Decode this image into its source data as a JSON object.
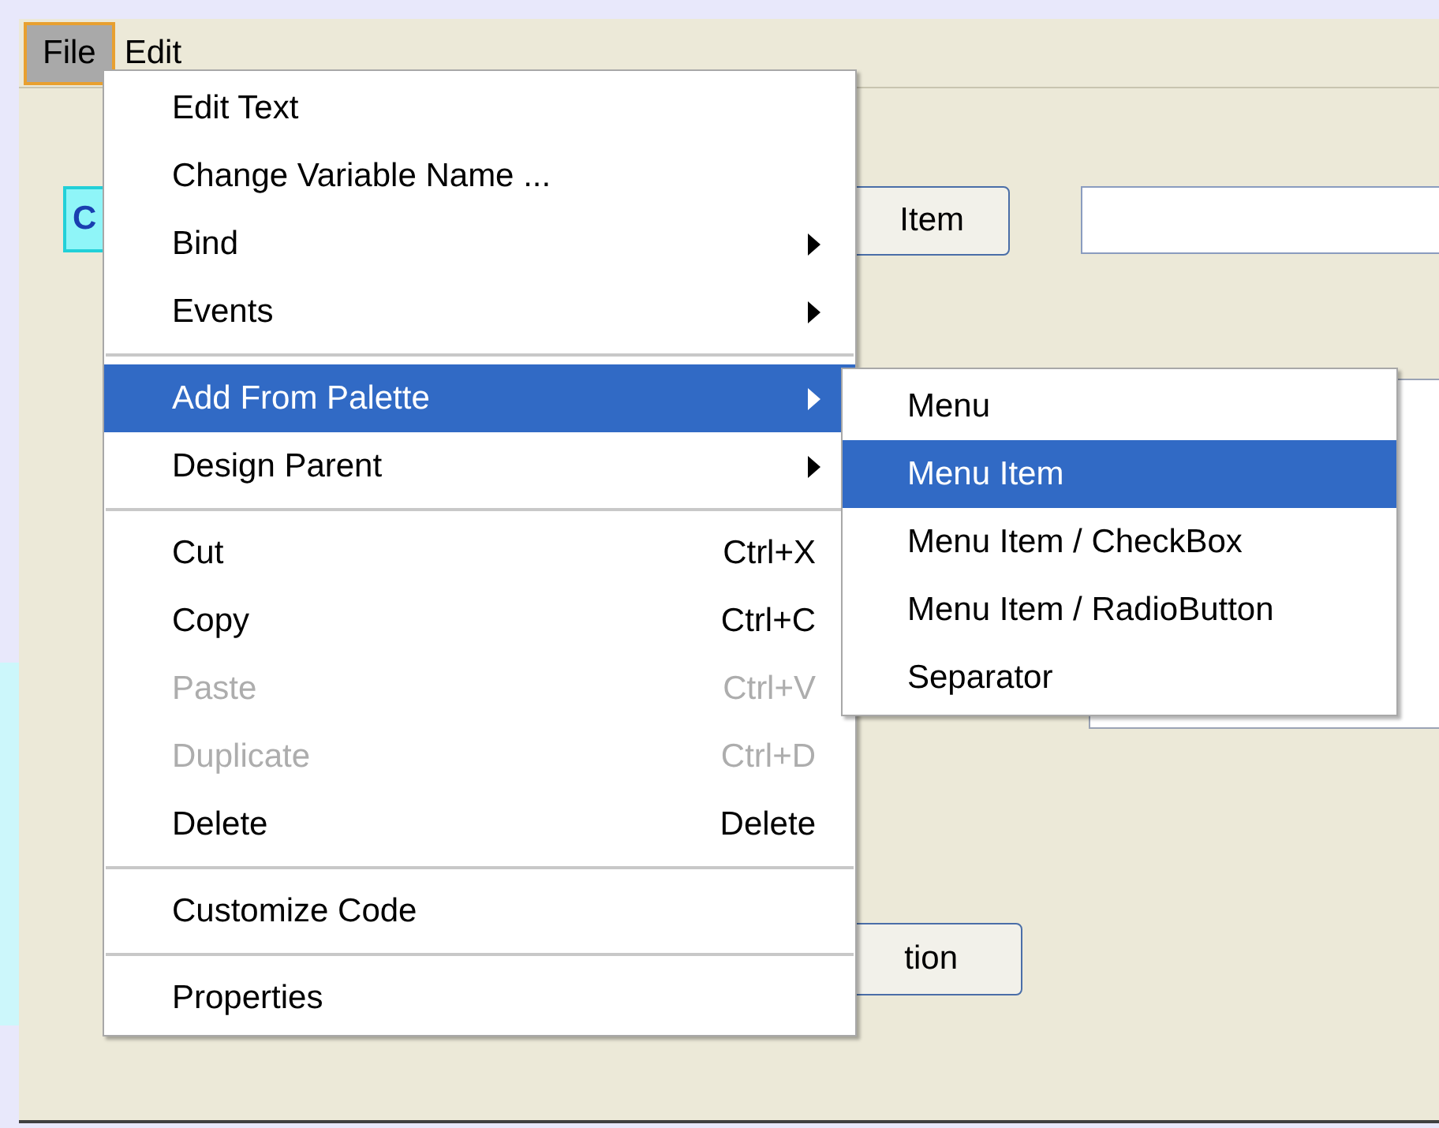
{
  "menubar": [
    {
      "label": "File",
      "selected": true
    },
    {
      "label": "Edit",
      "selected": false
    }
  ],
  "form": {
    "buttons": [
      {
        "kind": "selected",
        "label": "C"
      },
      {
        "kind": "normal",
        "label": "Item"
      },
      {
        "kind": "normal",
        "label": "tion"
      }
    ]
  },
  "context_menu": [
    {
      "kind": "item",
      "label": "Edit Text",
      "disabled": false,
      "selected": false
    },
    {
      "kind": "item",
      "label": "Change Variable Name ...",
      "disabled": false,
      "selected": false
    },
    {
      "kind": "item",
      "label": "Bind",
      "disabled": false,
      "selected": false,
      "submenu": true
    },
    {
      "kind": "item",
      "label": "Events",
      "disabled": false,
      "selected": false,
      "submenu": true
    },
    {
      "kind": "separator"
    },
    {
      "kind": "item",
      "label": "Add From Palette",
      "disabled": false,
      "selected": true,
      "submenu": true
    },
    {
      "kind": "item",
      "label": "Design Parent",
      "disabled": false,
      "selected": false,
      "submenu": true
    },
    {
      "kind": "separator"
    },
    {
      "kind": "item",
      "label": "Cut",
      "shortcut": "Ctrl+X",
      "disabled": false,
      "selected": false
    },
    {
      "kind": "item",
      "label": "Copy",
      "shortcut": "Ctrl+C",
      "disabled": false,
      "selected": false
    },
    {
      "kind": "item",
      "label": "Paste",
      "shortcut": "Ctrl+V",
      "disabled": true,
      "selected": false
    },
    {
      "kind": "item",
      "label": "Duplicate",
      "shortcut": "Ctrl+D",
      "disabled": true,
      "selected": false
    },
    {
      "kind": "item",
      "label": "Delete",
      "shortcut": "Delete",
      "disabled": false,
      "selected": false
    },
    {
      "kind": "separator"
    },
    {
      "kind": "item",
      "label": "Customize Code",
      "disabled": false,
      "selected": false
    },
    {
      "kind": "separator"
    },
    {
      "kind": "item",
      "label": "Properties",
      "disabled": false,
      "selected": false
    }
  ],
  "submenu": [
    {
      "label": "Menu",
      "selected": false
    },
    {
      "label": "Menu Item",
      "selected": true
    },
    {
      "label": "Menu Item / CheckBox",
      "selected": false
    },
    {
      "label": "Menu Item / RadioButton",
      "selected": false
    },
    {
      "label": "Separator",
      "selected": false
    }
  ]
}
